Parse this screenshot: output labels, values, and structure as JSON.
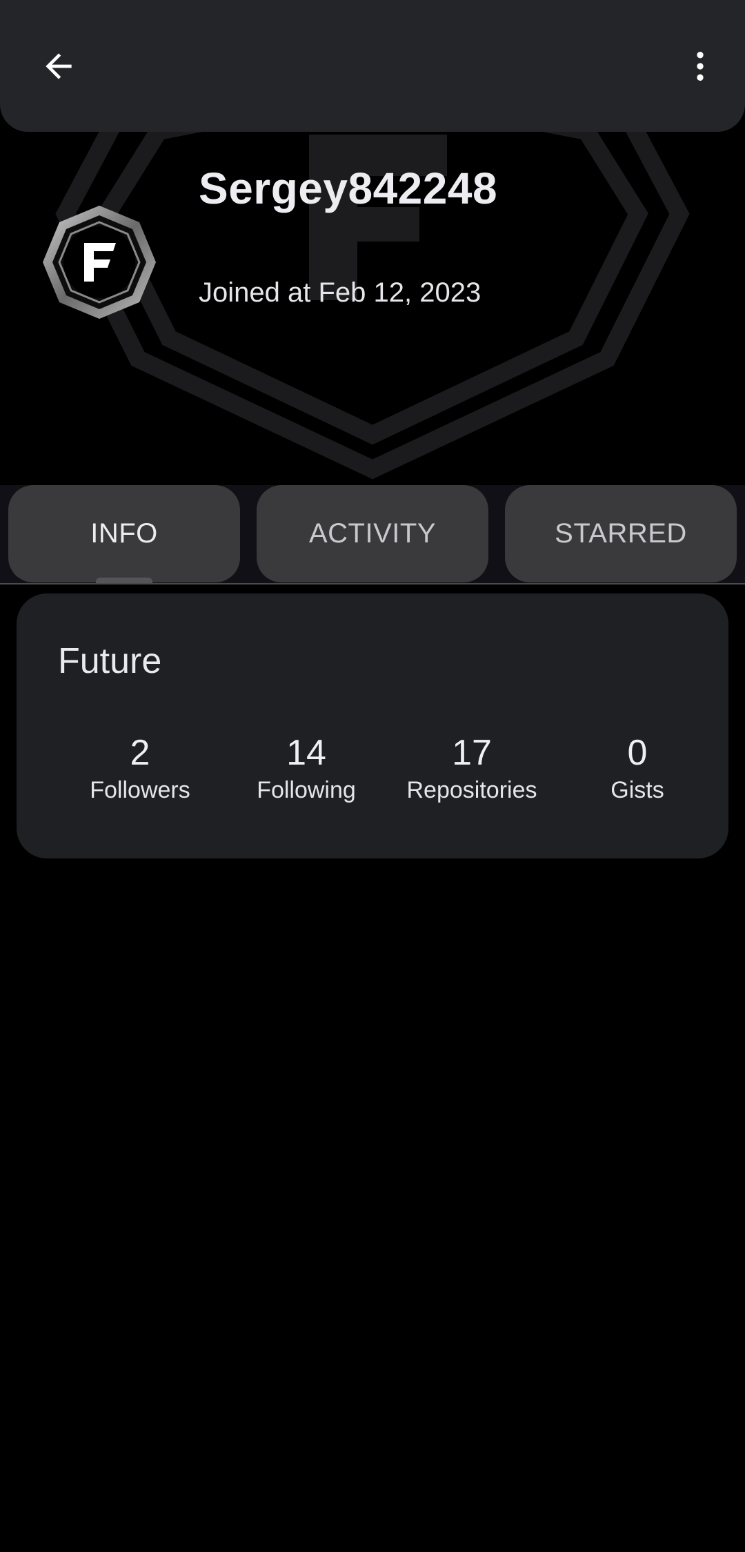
{
  "topbar": {
    "back_icon": "arrow-left-icon",
    "more_icon": "more-vertical-icon"
  },
  "profile": {
    "username": "Sergey842248",
    "joined": "Joined at Feb 12, 2023",
    "avatar_letter": "F"
  },
  "tabs": [
    {
      "label": "INFO",
      "selected": true
    },
    {
      "label": "ACTIVITY",
      "selected": false
    },
    {
      "label": "STARRED",
      "selected": false
    }
  ],
  "info_card": {
    "company": "Future",
    "stats": [
      {
        "value": "2",
        "label": "Followers"
      },
      {
        "value": "14",
        "label": "Following"
      },
      {
        "value": "17",
        "label": "Repositories"
      },
      {
        "value": "0",
        "label": "Gists"
      }
    ]
  },
  "colors": {
    "background": "#000000",
    "topbar": "#242529",
    "tab": "#3a3a3c",
    "card": "#1f2023"
  }
}
